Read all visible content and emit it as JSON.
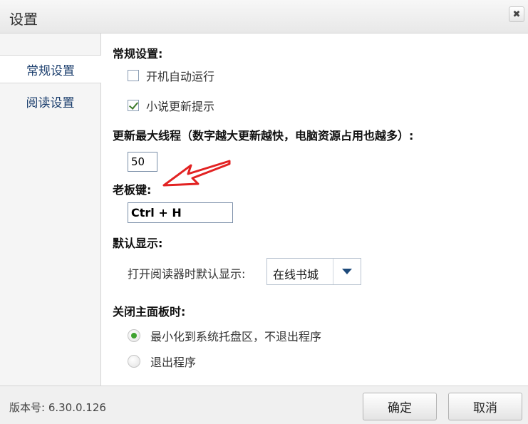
{
  "window": {
    "title": "设置",
    "close_glyph": "✖"
  },
  "sidebar": {
    "items": [
      {
        "label": "常规设置",
        "active": true
      },
      {
        "label": "阅读设置",
        "active": false
      }
    ]
  },
  "general": {
    "section_label": "常规设置:",
    "autostart": {
      "label": "开机自动运行",
      "checked": false
    },
    "update_hint": {
      "label": "小说更新提示",
      "checked": true
    }
  },
  "threads": {
    "label": "更新最大线程（数字越大更新越快，电脑资源占用也越多）:",
    "value": "50"
  },
  "boss_key": {
    "label": "老板键:",
    "value": "Ctrl + H"
  },
  "default_display": {
    "section_label": "默认显示:",
    "prompt": "打开阅读器时默认显示:",
    "selected": "在线书城"
  },
  "close_panel": {
    "section_label": "关闭主面板时:",
    "options": [
      {
        "label": "最小化到系统托盘区，不退出程序",
        "selected": true
      },
      {
        "label": "退出程序",
        "selected": false
      }
    ]
  },
  "footer": {
    "version": "版本号: 6.30.0.126",
    "ok_label": "确定",
    "cancel_label": "取消"
  },
  "colors": {
    "accent": "#1d4a7a",
    "radio_selected": "#3ea22f",
    "annotation_arrow": "#e22222"
  },
  "icons": {
    "annotation": "red-arrow-icon",
    "close": "close-icon",
    "dropdown": "chevron-down-icon"
  }
}
